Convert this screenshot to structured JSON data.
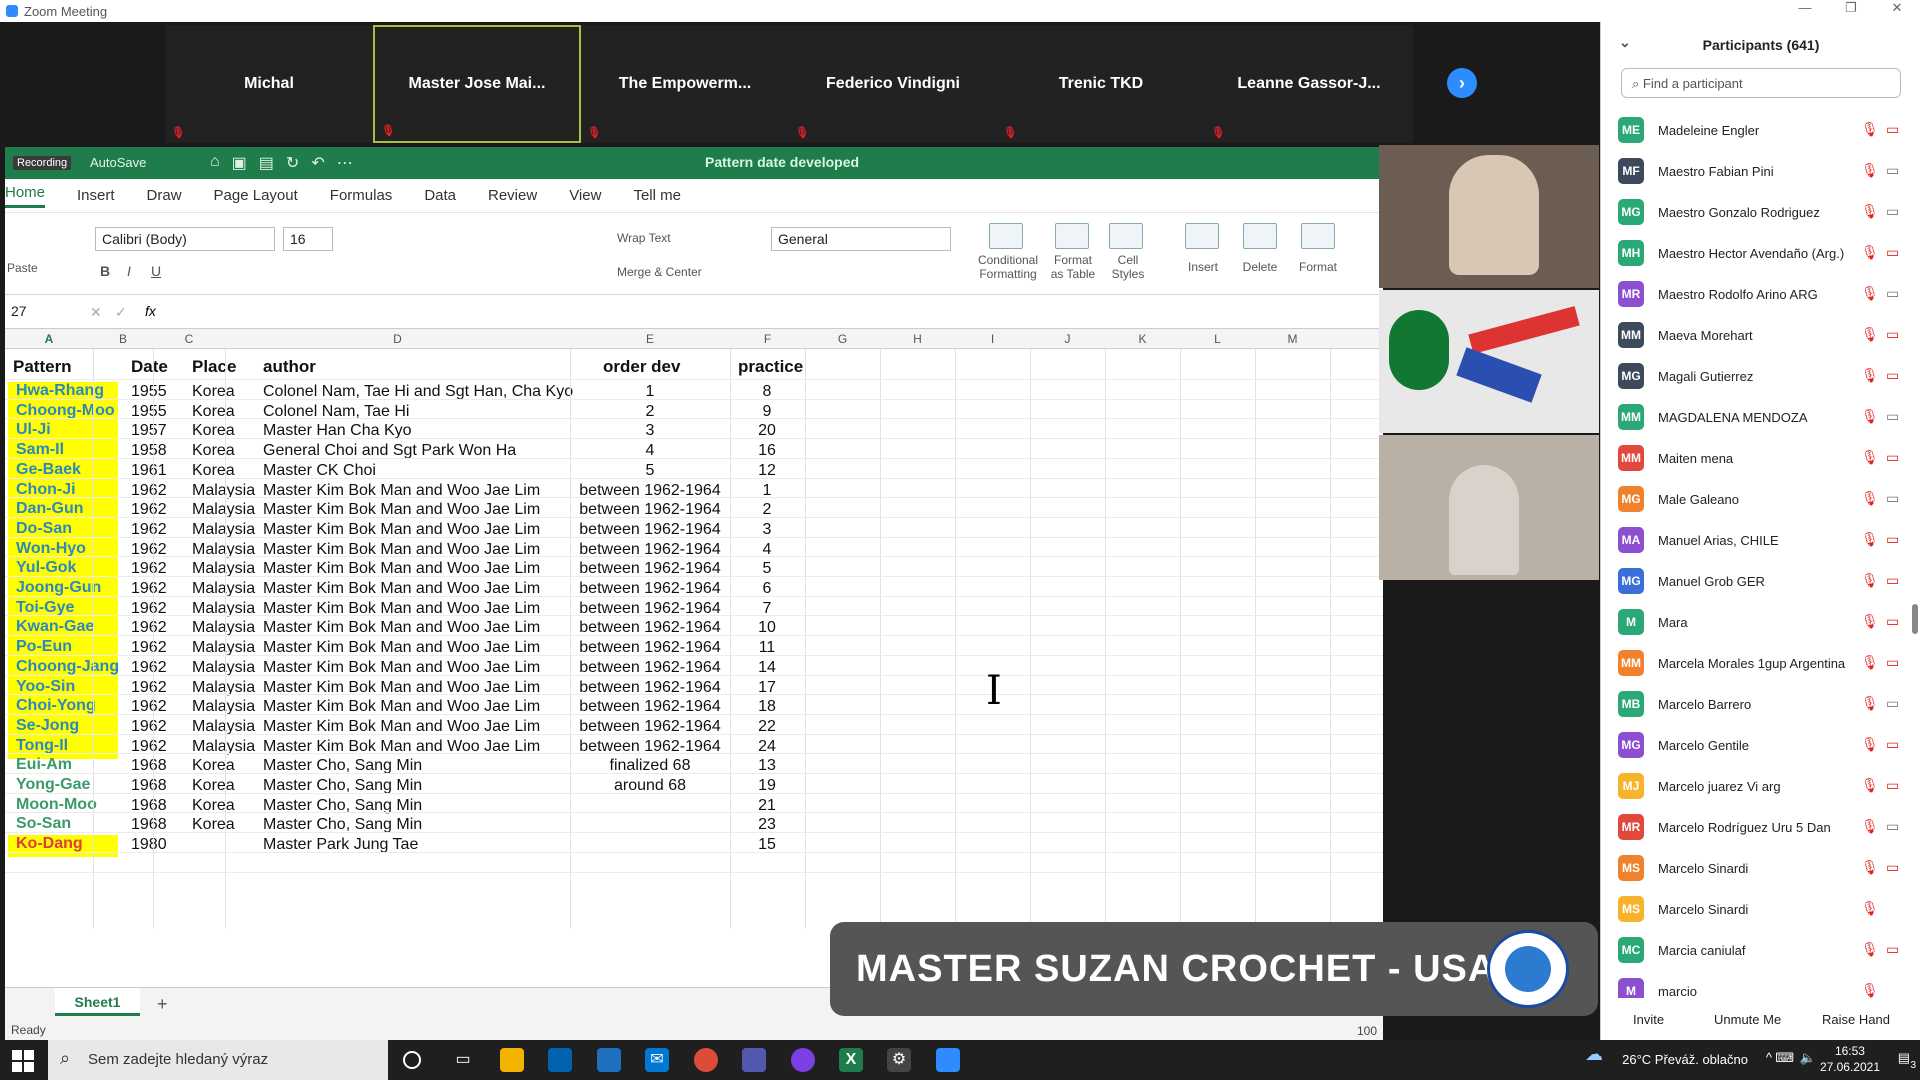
{
  "window": {
    "title": "Zoom Meeting",
    "controls": [
      "—",
      "❐",
      "✕"
    ]
  },
  "strip": {
    "tiles": [
      "Michal",
      "Master  Jose  Mai...",
      "The  Empowerm...",
      "Federico Vindigni",
      "Trenic TKD",
      "Leanne  Gassor-J..."
    ],
    "next_icon": "›"
  },
  "excel": {
    "recording": "Recording",
    "autosave": "AutoSave",
    "doc_title": "Pattern date developed",
    "tabs": [
      "Home",
      "Insert",
      "Draw",
      "Page Layout",
      "Formulas",
      "Data",
      "Review",
      "View",
      "Tell me"
    ],
    "ribbon": {
      "paste": "Paste",
      "font": "Calibri (Body)",
      "size": "16",
      "wrap": "Wrap Text",
      "merge": "Merge & Center",
      "number_format": "General",
      "cond1": "Conditional",
      "cond2": "Formatting",
      "fmt1": "Format",
      "fmt2": "as Table",
      "cell1": "Cell",
      "cell2": "Styles",
      "insert": "Insert",
      "delete": "Delete",
      "format": "Format"
    },
    "name_box": "27",
    "fx": "fx",
    "columns": [
      "A",
      "B",
      "C",
      "D",
      "E",
      "F",
      "G",
      "H",
      "I",
      "J",
      "K",
      "L",
      "M"
    ],
    "header": {
      "pattern": "Pattern",
      "date": "Date",
      "place": "Place",
      "author": "author",
      "order": "order dev",
      "practice": "practice"
    },
    "rows": [
      [
        "Hwa-Rhang",
        "1955",
        "Korea",
        "Colonel Nam, Tae Hi and Sgt Han, Cha Kyo",
        "1",
        "8"
      ],
      [
        "Choong-Moo",
        "1955",
        "Korea",
        "Colonel Nam, Tae Hi",
        "2",
        "9"
      ],
      [
        "Ul-Ji",
        "1957",
        "Korea",
        "Master Han Cha Kyo",
        "3",
        "20"
      ],
      [
        "Sam-Il",
        "1958",
        "Korea",
        "General Choi and Sgt Park Won Ha",
        "4",
        "16"
      ],
      [
        "Ge-Baek",
        "1961",
        "Korea",
        "Master CK Choi",
        "5",
        "12"
      ],
      [
        "Chon-Ji",
        "1962",
        "Malaysia",
        "Master Kim Bok Man and Woo Jae Lim",
        "between 1962-1964",
        "1"
      ],
      [
        "Dan-Gun",
        "1962",
        "Malaysia",
        "Master Kim Bok Man and Woo Jae Lim",
        "between 1962-1964",
        "2"
      ],
      [
        "Do-San",
        "1962",
        "Malaysia",
        "Master Kim Bok Man and Woo Jae Lim",
        "between 1962-1964",
        "3"
      ],
      [
        "Won-Hyo",
        "1962",
        "Malaysia",
        "Master Kim Bok Man and Woo Jae Lim",
        "between 1962-1964",
        "4"
      ],
      [
        "Yul-Gok",
        "1962",
        "Malaysia",
        "Master Kim Bok Man and Woo Jae Lim",
        "between 1962-1964",
        "5"
      ],
      [
        "Joong-Gun",
        "1962",
        "Malaysia",
        "Master Kim Bok Man and Woo Jae Lim",
        "between 1962-1964",
        "6"
      ],
      [
        "Toi-Gye",
        "1962",
        "Malaysia",
        "Master Kim Bok Man and Woo Jae Lim",
        "between 1962-1964",
        "7"
      ],
      [
        "Kwan-Gae",
        "1962",
        "Malaysia",
        "Master Kim Bok Man and Woo Jae Lim",
        "between 1962-1964",
        "10"
      ],
      [
        "Po-Eun",
        "1962",
        "Malaysia",
        "Master Kim Bok Man and Woo Jae Lim",
        "between 1962-1964",
        "11"
      ],
      [
        "Choong-Jang",
        "1962",
        "Malaysia",
        "Master Kim Bok Man and Woo Jae Lim",
        "between 1962-1964",
        "14"
      ],
      [
        "Yoo-Sin",
        "1962",
        "Malaysia",
        "Master Kim Bok Man and Woo Jae Lim",
        "between 1962-1964",
        "17"
      ],
      [
        "Choi-Yong",
        "1962",
        "Malaysia",
        "Master Kim Bok Man and Woo Jae Lim",
        "between 1962-1964",
        "18"
      ],
      [
        "Se-Jong",
        "1962",
        "Malaysia",
        "Master Kim Bok Man and Woo Jae Lim",
        "between 1962-1964",
        "22"
      ],
      [
        "Tong-Il",
        "1962",
        "Malaysia",
        "Master Kim Bok Man and Woo Jae Lim",
        "between 1962-1964",
        "24"
      ],
      [
        "Eui-Am",
        "1968",
        "Korea",
        "Master Cho, Sang Min",
        "finalized 68",
        "13"
      ],
      [
        "Yong-Gae",
        "1968",
        "Korea",
        "Master Cho, Sang Min",
        "around 68",
        "19"
      ],
      [
        "Moon-Moo",
        "1968",
        "Korea",
        "Master Cho, Sang Min",
        "",
        "21"
      ],
      [
        "So-San",
        "1968",
        "Korea",
        "Master Cho, Sang Min",
        "",
        "23"
      ],
      [
        "Ko-Dang",
        "1980",
        "",
        "Master Park Jung Tae",
        "",
        "15"
      ]
    ],
    "sheet_tab": "Sheet1",
    "add_sheet": "+",
    "status": "Ready",
    "zoom": "100"
  },
  "banner": {
    "text": "MASTER SUZAN CROCHET - USA"
  },
  "participants": {
    "title": "Participants (641)",
    "search_placeholder": "Find a participant",
    "list": [
      {
        "i": "ME",
        "n": "Madeleine Engler",
        "c": "#2aa876",
        "v": false
      },
      {
        "i": "MF",
        "n": "Maestro Fabian Pini",
        "c": "#3d4a5c",
        "v": true
      },
      {
        "i": "MG",
        "n": "Maestro Gonzalo Rodriguez",
        "c": "#2aa876",
        "v": true
      },
      {
        "i": "MH",
        "n": "Maestro Hector Avendaño (Arg.)",
        "c": "#2aa876",
        "v": false
      },
      {
        "i": "MR",
        "n": "Maestro Rodolfo Arino ARG",
        "c": "#8c4fd0",
        "v": true
      },
      {
        "i": "MM",
        "n": "Maeva Morehart",
        "c": "#3d4a5c",
        "v": false
      },
      {
        "i": "MG",
        "n": "Magali Gutierrez",
        "c": "#3d4a5c",
        "v": false
      },
      {
        "i": "MM",
        "n": "MAGDALENA MENDOZA",
        "c": "#2aa876",
        "v": true
      },
      {
        "i": "MM",
        "n": "Maiten mena",
        "c": "#e2483c",
        "v": false
      },
      {
        "i": "MG",
        "n": "Male Galeano",
        "c": "#f0822e",
        "v": true
      },
      {
        "i": "MA",
        "n": "Manuel Arias, CHILE",
        "c": "#8c4fd0",
        "v": false
      },
      {
        "i": "MG",
        "n": "Manuel Grob GER",
        "c": "#3b6fd8",
        "v": false
      },
      {
        "i": "M",
        "n": "Mara",
        "c": "#2aa876",
        "v": false
      },
      {
        "i": "MM",
        "n": "Marcela Morales 1gup Argentina",
        "c": "#f0822e",
        "v": false
      },
      {
        "i": "MB",
        "n": "Marcelo Barrero",
        "c": "#2aa876",
        "v": true
      },
      {
        "i": "MG",
        "n": "Marcelo Gentile",
        "c": "#8c4fd0",
        "v": false
      },
      {
        "i": "MJ",
        "n": "Marcelo juarez  Vi arg",
        "c": "#f7b32b",
        "v": false
      },
      {
        "i": "MR",
        "n": "Marcelo Rodríguez Uru 5 Dan",
        "c": "#e2483c",
        "v": true
      },
      {
        "i": "MS",
        "n": "Marcelo Sinardi",
        "c": "#f0822e",
        "v": false
      },
      {
        "i": "MS",
        "n": "Marcelo Sinardi",
        "c": "#f7b32b",
        "v": null
      },
      {
        "i": "MC",
        "n": "Marcia caniulaf",
        "c": "#2aa876",
        "v": false
      },
      {
        "i": "M",
        "n": "marcio",
        "c": "#8c4fd0",
        "v": null
      }
    ],
    "invite": "Invite",
    "unmute": "Unmute Me",
    "raise": "Raise Hand"
  },
  "taskbar": {
    "search": "Sem zadejte hledaný výraz",
    "weather": "26°C  Převáž. oblačno",
    "time": "16:53",
    "date": "27.06.2021",
    "notif": "3"
  }
}
